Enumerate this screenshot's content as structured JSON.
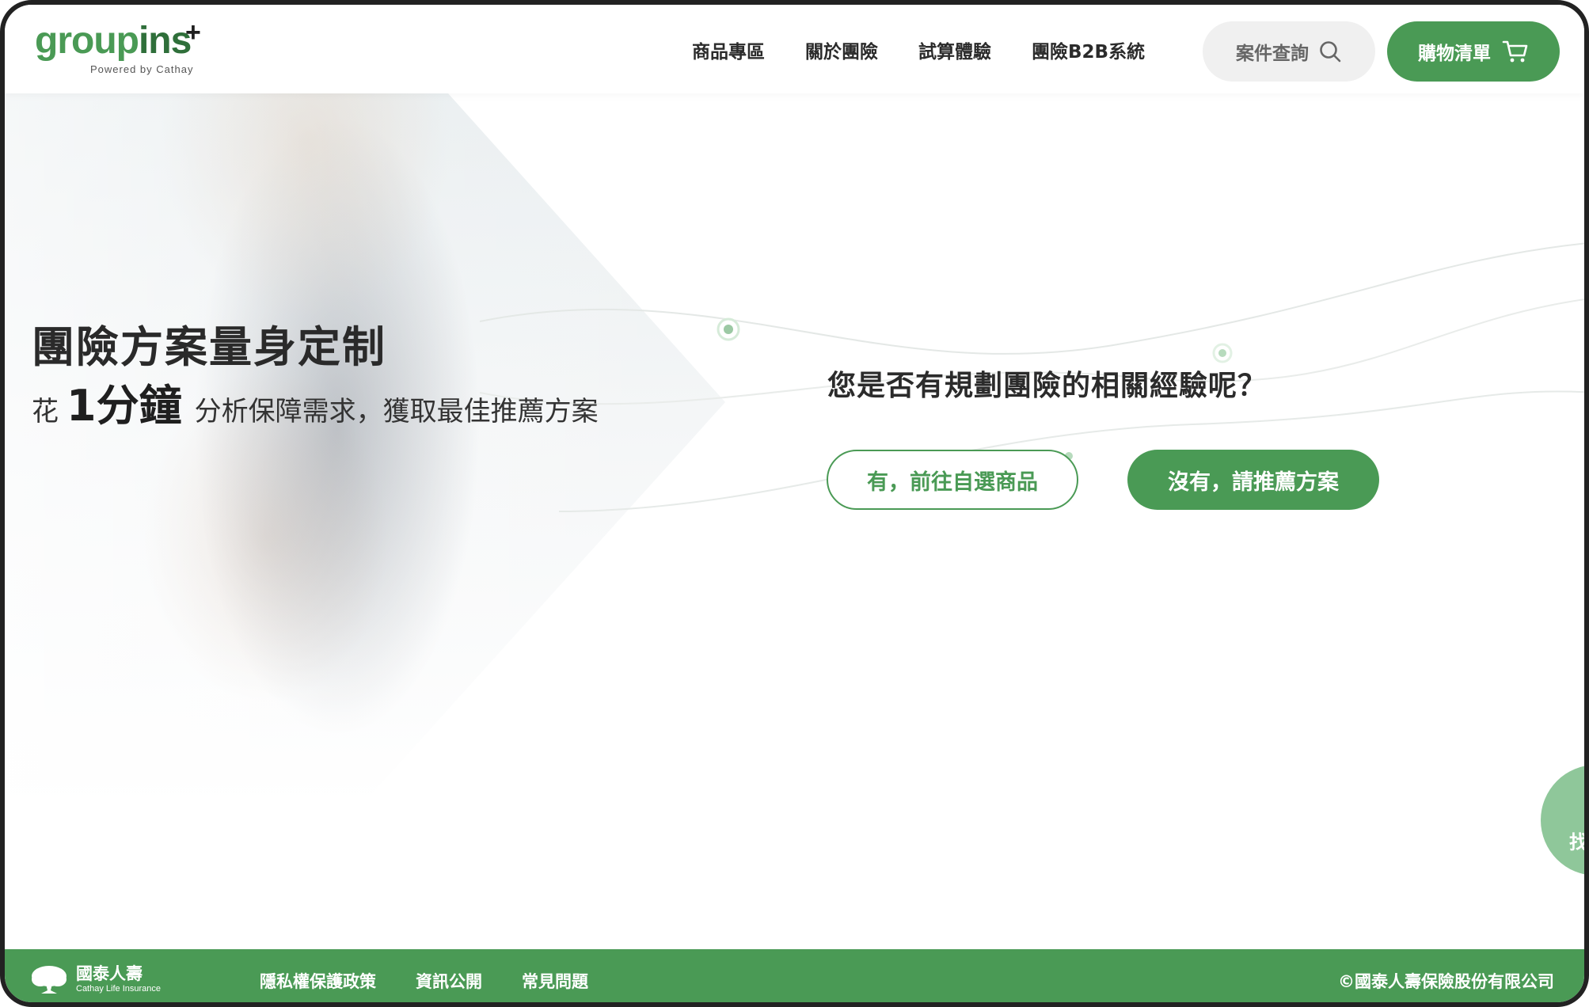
{
  "header": {
    "logo": {
      "main": "group",
      "accent": "ins",
      "plus": "+",
      "tagline": "Powered by Cathay"
    },
    "nav": [
      "商品專區",
      "關於團險",
      "試算體驗",
      "團險B2B系統"
    ],
    "search_label": "案件查詢",
    "cart_label": "購物清單"
  },
  "hero": {
    "title": "團險方案量身定制",
    "subtitle_pre": "花",
    "subtitle_big": "1分鐘",
    "subtitle_rest": "分析保障需求，獲取最佳推薦方案"
  },
  "main": {
    "question": "您是否有規劃團險的相關經驗呢？",
    "yes_button": "有，前往自選商品",
    "no_button": "沒有，請推薦方案"
  },
  "floating": {
    "label": "找"
  },
  "footer": {
    "logo_name": "國泰人壽",
    "logo_en": "Cathay Life Insurance",
    "links": [
      "隱私權保護政策",
      "資訊公開",
      "常見問題"
    ],
    "copyright": "©國泰人壽保險股份有限公司"
  },
  "colors": {
    "brand": "#4a9a55",
    "brand_light": "#8fc79a",
    "text": "#2b2b2b"
  }
}
